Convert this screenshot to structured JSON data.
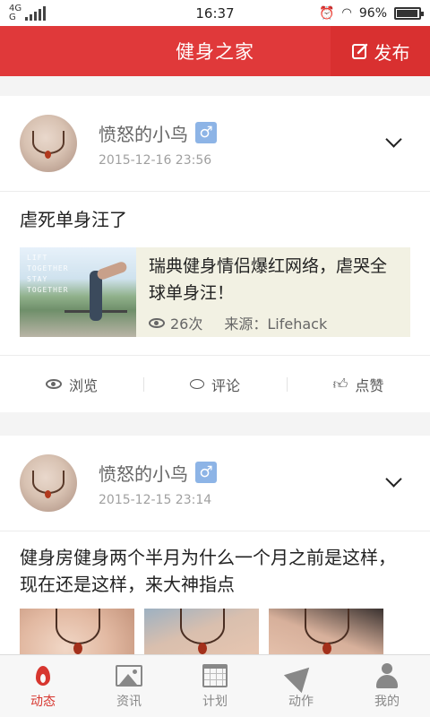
{
  "status_bar": {
    "network_top": "4G",
    "network_bottom": "G",
    "time": "16:37",
    "battery": "96%",
    "icons": [
      "alarm-icon",
      "wifi-icon",
      "battery-icon"
    ]
  },
  "app_bar": {
    "title": "健身之家",
    "publish_label": "发布",
    "publish_icon": "edit-icon"
  },
  "posts": [
    {
      "username": "愤怒的小鸟",
      "gender": "♂",
      "date": "2015-12-16 23:56",
      "text": "虐死单身汪了",
      "link": {
        "title": "瑞典健身情侣爆红网络，虐哭全球单身汪！",
        "thumb_text": [
          "LIFT",
          "TOGETHER",
          "STAY",
          "TOGETHER"
        ],
        "views": "26次",
        "source": "来源：Lifehack"
      }
    },
    {
      "username": "愤怒的小鸟",
      "gender": "♂",
      "date": "2015-12-15 23:14",
      "text": "健身房健身两个半月为什么一个月之前是这样，现在还是这样，来大神指点"
    }
  ],
  "actions": {
    "browse": "浏览",
    "comment": "评论",
    "like": "点赞"
  },
  "bottom_nav": [
    {
      "label": "动态",
      "icon": "flame-icon",
      "active": true
    },
    {
      "label": "资讯",
      "icon": "image-icon"
    },
    {
      "label": "计划",
      "icon": "calendar-icon"
    },
    {
      "label": "动作",
      "icon": "paper-plane-icon"
    },
    {
      "label": "我的",
      "icon": "person-icon"
    }
  ],
  "colors": {
    "accent": "#e0393a",
    "gender_badge": "#8db4e6",
    "link_bg": "#f2f1e3"
  }
}
